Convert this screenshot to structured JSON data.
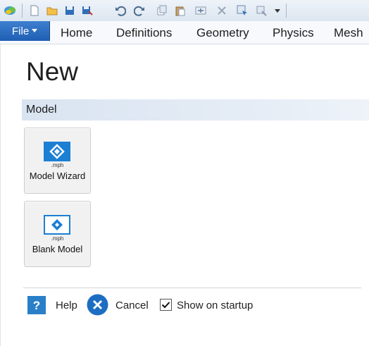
{
  "toolbar": {
    "icons": [
      "app-icon",
      "new-file-icon",
      "open-folder-icon",
      "save-icon",
      "save-as-icon",
      "undo-icon",
      "redo-icon",
      "copy-icon",
      "paste-icon",
      "duplicate-icon",
      "delete-icon",
      "select-icon",
      "settings-icon",
      "dropdown-arrow-icon"
    ]
  },
  "ribbon": {
    "file_label": "File",
    "tabs": [
      "Home",
      "Definitions",
      "Geometry",
      "Physics",
      "Mesh"
    ]
  },
  "page": {
    "title": "New",
    "section_label": "Model",
    "tiles": [
      {
        "ext": ".mph",
        "label": "Model Wizard"
      },
      {
        "ext": ".mph",
        "label": "Blank Model"
      }
    ]
  },
  "footer": {
    "help_label": "Help",
    "cancel_label": "Cancel",
    "show_on_startup_label": "Show on startup",
    "show_on_startup_checked": true
  },
  "colors": {
    "accent": "#1f5fb4",
    "tile_icon": "#1b7fd4",
    "help_icon": "#2a7fc9",
    "cancel_icon": "#1d6ec2"
  }
}
